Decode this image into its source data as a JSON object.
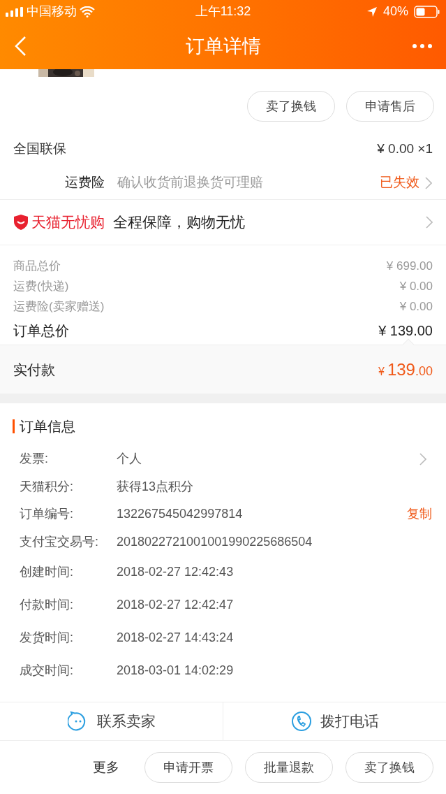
{
  "status_bar": {
    "carrier": "中国移动",
    "time": "上午11:32",
    "battery": "40%"
  },
  "nav": {
    "title": "订单详情"
  },
  "product": {
    "kind": "picture",
    "buttons": [
      "卖了换钱",
      "申请售后"
    ]
  },
  "warranty": {
    "label": "全国联保",
    "price": "¥ 0.00 ×1"
  },
  "shipping_insurance": {
    "label": "运费险",
    "description": "确认收货前退换货可理赔",
    "status": "已失效"
  },
  "guarantee": {
    "brand": "天猫无忧购",
    "slogan": "全程保障，购物无忧"
  },
  "price_rows": [
    {
      "label": "商品总价",
      "value": "¥ 699.00"
    },
    {
      "label": "运费(快递)",
      "value": "¥ 0.00"
    },
    {
      "label": "运费险(卖家赠送)",
      "value": "¥ 0.00"
    }
  ],
  "order_total": {
    "label": "订单总价",
    "value": "¥ 139.00"
  },
  "paid": {
    "label": "实付款",
    "currency": "¥",
    "integer": "139",
    "decimal": ".00"
  },
  "order_info": {
    "title": "订单信息",
    "rows": [
      {
        "label": "发票:",
        "value": "个人",
        "kind": "link"
      },
      {
        "label": "天猫积分:",
        "value": "获得13点积分",
        "kind": "plain"
      },
      {
        "label": "订单编号:",
        "value": "132267545042997814",
        "kind": "copy",
        "action": "复制"
      },
      {
        "label": "支付宝交易号:",
        "value": "2018022721001001990225686504",
        "kind": "plain"
      },
      {
        "label": "创建时间:",
        "value": "2018-02-27 12:42:43",
        "kind": "plain"
      },
      {
        "label": "付款时间:",
        "value": "2018-02-27 12:42:47",
        "kind": "plain"
      },
      {
        "label": "发货时间:",
        "value": "2018-02-27 14:43:24",
        "kind": "plain"
      },
      {
        "label": "成交时间:",
        "value": "2018-03-01 14:02:29",
        "kind": "plain"
      }
    ]
  },
  "contact": [
    {
      "label": "联系卖家",
      "kind": "chat"
    },
    {
      "label": "拨打电话",
      "kind": "phone"
    }
  ],
  "footer": {
    "more": "更多",
    "buttons": [
      "申请开票",
      "批量退款",
      "卖了换钱"
    ]
  }
}
